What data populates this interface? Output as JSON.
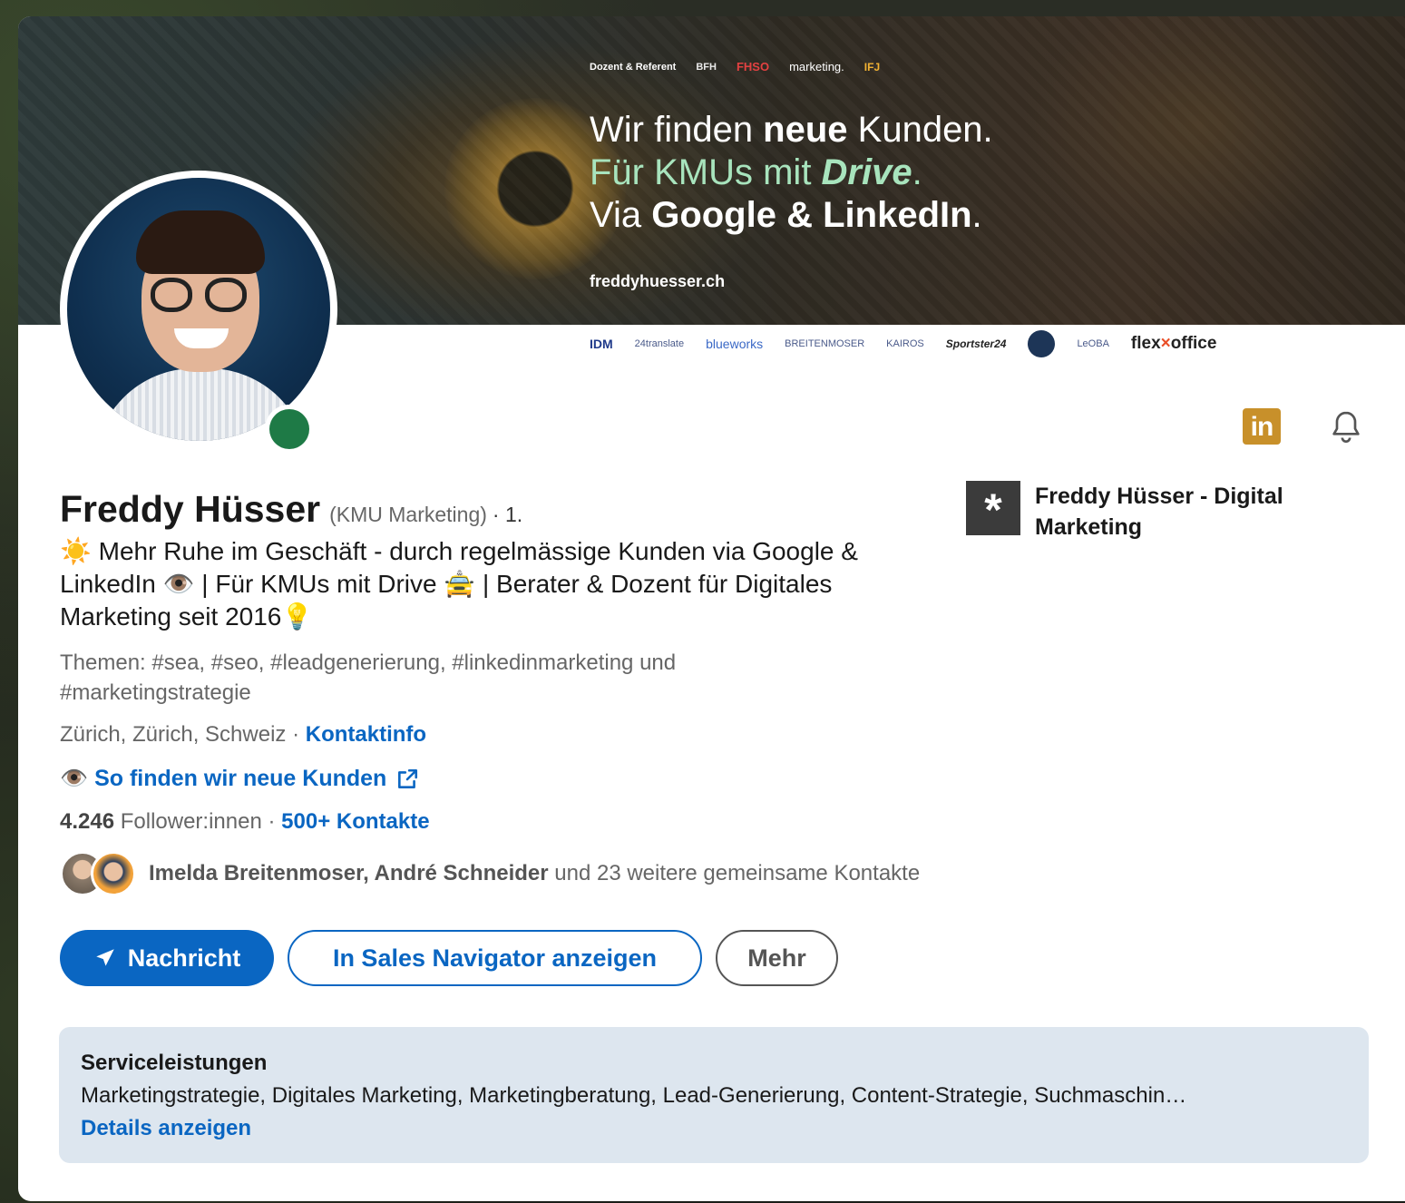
{
  "banner": {
    "top_label": "Dozent & Referent",
    "top_logos": [
      "BFH",
      "FHSO",
      "marketing.",
      "IFJ"
    ],
    "headline_line1_a": "Wir finden ",
    "headline_line1_b": "neue",
    "headline_line1_c": " Kunden.",
    "headline_line2_a": "Für KMUs mit ",
    "headline_line2_b": "Drive",
    "headline_line2_c": ".",
    "headline_line3_a": "Via ",
    "headline_line3_b": "Google & LinkedIn",
    "headline_line3_c": ".",
    "url": "freddyhuesser.ch",
    "client_logos": [
      "IDM",
      "24translate",
      "blueworks",
      "BREITENMOSER",
      "KAIROS",
      "Sportster24",
      "LeOBA",
      "flexoffice"
    ]
  },
  "profile": {
    "name": "Freddy Hüsser",
    "pronoun_note": "(KMU Marketing)",
    "degree": "· 1.",
    "headline": "☀️ Mehr Ruhe im Geschäft - durch regelmässige Kunden via Google & LinkedIn 👁️ | Für KMUs mit Drive 🚖 | Berater & Dozent für Digitales Marketing seit 2016💡",
    "topics": "Themen: #sea, #seo, #leadgenerierung, #linkedinmarketing und #marketingstrategie",
    "location": "Zürich, Zürich, Schweiz",
    "location_sep": " · ",
    "contact_info": "Kontaktinfo",
    "website_label": "👁️ So finden wir neue Kunden",
    "followers_count": "4.246",
    "followers_label": " Follower:innen ",
    "followers_sep": " · ",
    "connections": "500+ Kontakte",
    "mutual_names": "Imelda Breitenmoser, André Schneider",
    "mutual_rest": " und 23 weitere gemeinsame Kontakte"
  },
  "company": {
    "name": "Freddy Hüsser - Digital Marketing"
  },
  "actions": {
    "message": "Nachricht",
    "sales_nav": "In Sales Navigator anzeigen",
    "more": "Mehr"
  },
  "services": {
    "title": "Serviceleistungen",
    "list": "Marketingstrategie, Digitales Marketing, Marketingberatung, Lead-Generierung, Content-Strategie, Suchmaschin…",
    "details": "Details anzeigen"
  },
  "icons": {
    "linkedin": "in",
    "company_logo": "*"
  },
  "colors": {
    "accent": "#0a66c2",
    "online": "#1e7a46",
    "linkedin_badge": "#c8902a",
    "services_bg": "#dde6ef"
  }
}
